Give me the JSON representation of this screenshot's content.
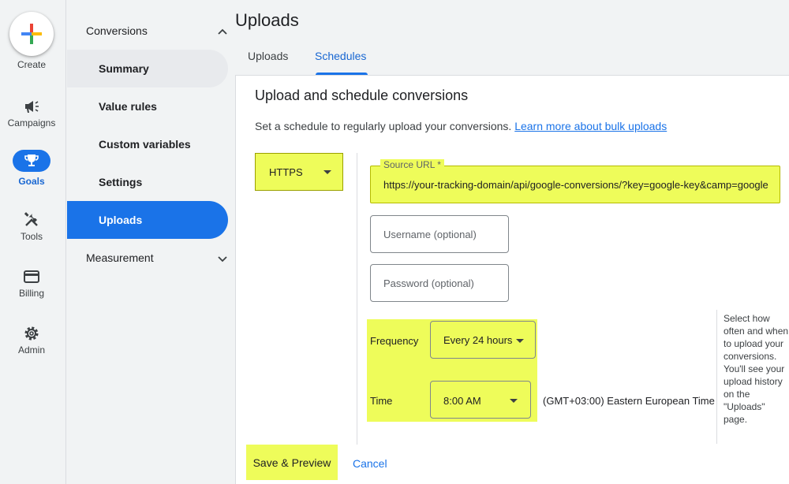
{
  "rail": {
    "create_label": "Create",
    "items": [
      {
        "label": "Campaigns",
        "icon": "megaphone-icon"
      },
      {
        "label": "Goals",
        "icon": "trophy-icon"
      },
      {
        "label": "Tools",
        "icon": "tools-icon"
      },
      {
        "label": "Billing",
        "icon": "credit-card-icon"
      },
      {
        "label": "Admin",
        "icon": "gear-icon"
      }
    ]
  },
  "subnav": {
    "conversions_label": "Conversions",
    "items": [
      "Summary",
      "Value rules",
      "Custom variables",
      "Settings",
      "Uploads"
    ],
    "measurement_label": "Measurement"
  },
  "main": {
    "title": "Uploads",
    "tabs": [
      "Uploads",
      "Schedules"
    ],
    "card": {
      "title": "Upload and schedule conversions",
      "description": "Set a schedule to regularly upload your conversions.",
      "learn_more": "Learn more about bulk uploads",
      "protocol": "HTTPS",
      "source_url_label": "Source URL *",
      "source_url_value": "https://your-tracking-domain/api/google-conversions/?key=google-key&camp=google",
      "username_placeholder": "Username (optional)",
      "password_placeholder": "Password (optional)",
      "frequency_label": "Frequency",
      "frequency_value": "Every 24 hours",
      "time_label": "Time",
      "time_value": "8:00 AM",
      "timezone": "(GMT+03:00) Eastern European Time",
      "help_text": "Select how often and when to upload your conversions. You'll see your upload history on the \"Uploads\" page.",
      "save_label": "Save & Preview",
      "cancel_label": "Cancel"
    }
  },
  "colors": {
    "accent": "#1a73e8",
    "highlight": "#eefc5a"
  }
}
